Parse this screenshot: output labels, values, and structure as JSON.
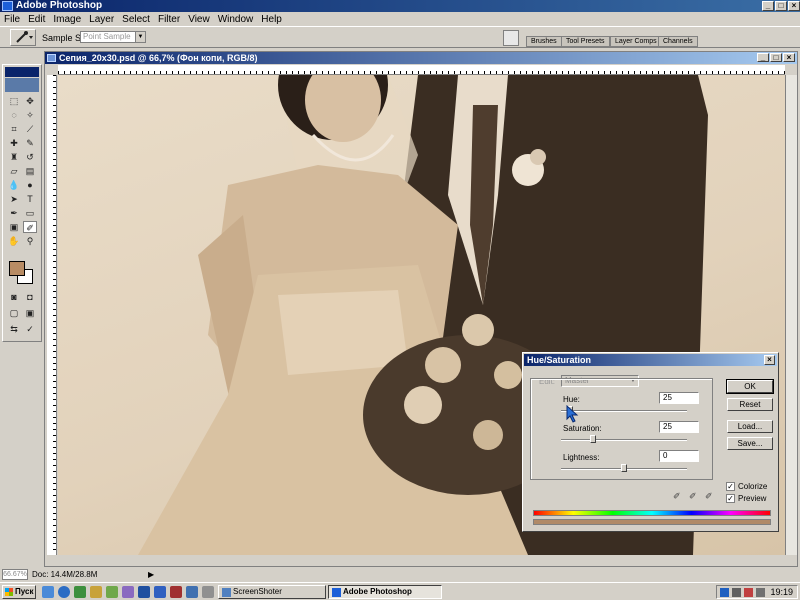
{
  "app": {
    "title": "Adobe Photoshop"
  },
  "menu": [
    "File",
    "Edit",
    "Image",
    "Layer",
    "Select",
    "Filter",
    "View",
    "Window",
    "Help"
  ],
  "options_bar": {
    "sample_size_label": "Sample Size:",
    "sample_size_value": "Point Sample",
    "palette_tabs": [
      "Brushes",
      "Tool Presets",
      "Layer Comps",
      "Channels"
    ]
  },
  "document": {
    "title": "Сепия_20x30.psd @ 66,7% (Фон копи, RGB/8)"
  },
  "status": {
    "zoom": "66.67%",
    "doc_size": "Doc: 14.4M/28.8M"
  },
  "dialog": {
    "title": "Hue/Saturation",
    "edit_label": "Edit:",
    "edit_value": "Master",
    "hue_label": "Hue:",
    "hue_value": "25",
    "saturation_label": "Saturation:",
    "saturation_value": "25",
    "lightness_label": "Lightness:",
    "lightness_value": "0",
    "ok_label": "OK",
    "reset_label": "Reset",
    "load_label": "Load...",
    "save_label": "Save...",
    "colorize_label": "Colorize",
    "preview_label": "Preview",
    "colorize_checked": true,
    "preview_checked": true,
    "slider_levels": {
      "hue": 0.07,
      "saturation": 0.25,
      "lightness": 0.5
    }
  },
  "taskbar": {
    "start_label": "Пуск",
    "tasks": [
      {
        "label": "ScreenShoter",
        "active": false
      },
      {
        "label": "Adobe Photoshop",
        "active": true
      }
    ],
    "clock": "19:19"
  },
  "colors": {
    "foreground": "#b88c64",
    "background": "#ffffff",
    "sepia_light": "#e4d6c0",
    "sepia_dark": "#3a2d22"
  }
}
